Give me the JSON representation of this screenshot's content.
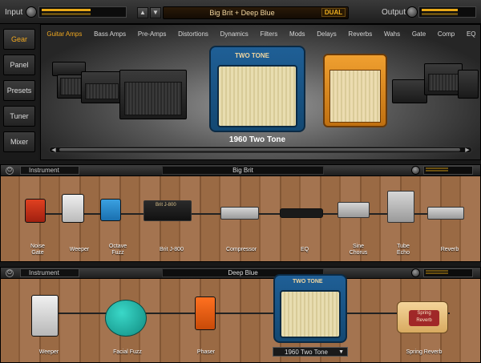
{
  "topbar": {
    "input_label": "Input",
    "output_label": "Output",
    "prev_arrow": "▲",
    "next_arrow": "▼",
    "preset_name": "Big Brit + Deep Blue",
    "mode_badge": "DUAL"
  },
  "nav": {
    "items": [
      {
        "label": "Gear",
        "active": true
      },
      {
        "label": "Panel",
        "active": false
      },
      {
        "label": "Presets",
        "active": false
      },
      {
        "label": "Tuner",
        "active": false
      },
      {
        "label": "Mixer",
        "active": false
      }
    ]
  },
  "browser": {
    "tabs": [
      {
        "label": "Guitar Amps",
        "active": true
      },
      {
        "label": "Bass Amps",
        "active": false
      },
      {
        "label": "Pre-Amps",
        "active": false
      },
      {
        "label": "Distortions",
        "active": false
      },
      {
        "label": "Dynamics",
        "active": false
      },
      {
        "label": "Filters",
        "active": false
      },
      {
        "label": "Mods",
        "active": false
      },
      {
        "label": "Delays",
        "active": false
      },
      {
        "label": "Reverbs",
        "active": false
      },
      {
        "label": "Wahs",
        "active": false
      },
      {
        "label": "Gate",
        "active": false
      },
      {
        "label": "Comp",
        "active": false
      },
      {
        "label": "EQ",
        "active": false
      }
    ],
    "selected_title": "1960 Two Tone",
    "amp_brand": "TWO TONE",
    "scroll_left": "◀",
    "scroll_right": "▶"
  },
  "chain1": {
    "source": "Instrument",
    "name": "Big Brit",
    "power_glyph": "⏻",
    "amp_badge": "Brit J-800",
    "devices": [
      {
        "label": "Noise\nGate"
      },
      {
        "label": "Weeper"
      },
      {
        "label": "Octave\nFuzz"
      },
      {
        "label": "Brit J-800"
      },
      {
        "label": "Compressor"
      },
      {
        "label": "EQ"
      },
      {
        "label": "Sine\nChorus"
      },
      {
        "label": "Tube\nEcho"
      },
      {
        "label": "Reverb"
      }
    ]
  },
  "chain2": {
    "source": "Instrument",
    "name": "Deep Blue",
    "power_glyph": "⏻",
    "devices": [
      {
        "label": "Weeper"
      },
      {
        "label": "Facial Fuzz"
      },
      {
        "label": "Phaser"
      },
      {
        "label": "Spring Reverb"
      }
    ],
    "amp_select": "1960 Two Tone",
    "amp_brand": "TWO TONE",
    "reverb_logo": "Spring Reverb"
  },
  "colors": {
    "accent": "#f0a820",
    "amp_blue": "#1a5a90",
    "wood": "#9a6a44"
  }
}
